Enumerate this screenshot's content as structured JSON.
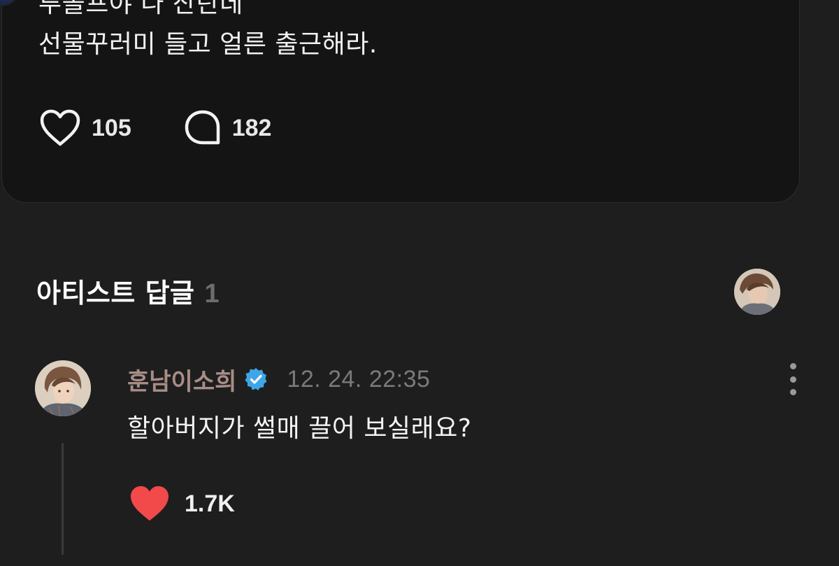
{
  "post": {
    "lines": [
      "루돌프야 나 산탄데",
      "선물꾸러미 들고 얼른 출근해라."
    ],
    "like_count": "105",
    "comment_count": "182"
  },
  "artist_replies": {
    "title": "아티스트 답글",
    "count": "1"
  },
  "reply": {
    "author": "훈남이소희",
    "timestamp": "12. 24. 22:35",
    "text": "할아버지가 썰매 끌어 보실래요?",
    "like_count": "1.7K"
  },
  "colors": {
    "background": "#1e1e1e",
    "card": "#141414",
    "author_name": "#a88d86",
    "verified_badge": "#3ea6e6",
    "liked_heart": "#f2494a",
    "muted_text": "#7a7a7a"
  },
  "icons": {
    "like": "heart-outline-icon",
    "comment": "speech-bubble-icon",
    "verified": "verified-badge-icon",
    "more": "more-vertical-icon",
    "liked": "heart-filled-icon"
  }
}
